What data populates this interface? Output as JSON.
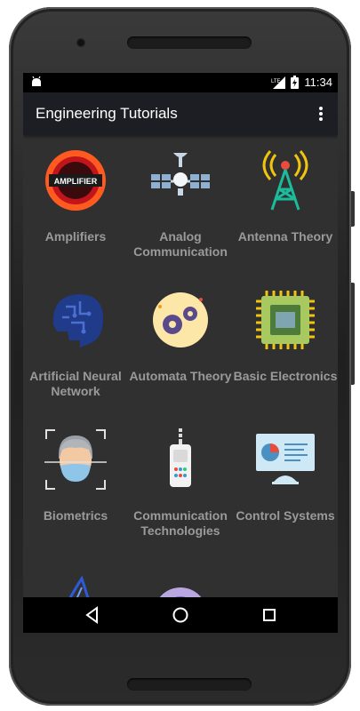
{
  "status": {
    "time": "11:34",
    "network": "LTE"
  },
  "appbar": {
    "title": "Engineering Tutorials"
  },
  "tiles": [
    {
      "label": "Amplifiers",
      "icon_text": "AMPLIFIER"
    },
    {
      "label": "Analog Communication"
    },
    {
      "label": "Antenna Theory"
    },
    {
      "label": "Artificial Neural Network"
    },
    {
      "label": "Automata Theory"
    },
    {
      "label": "Basic Electronics"
    },
    {
      "label": "Biometrics"
    },
    {
      "label": "Communication Technologies"
    },
    {
      "label": "Control Systems"
    }
  ]
}
